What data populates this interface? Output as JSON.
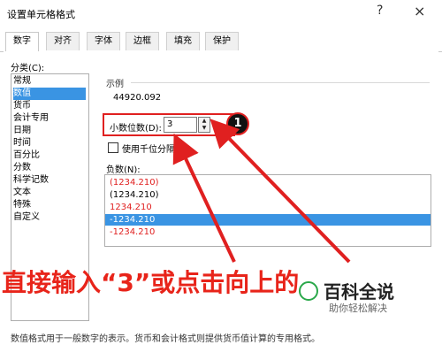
{
  "window": {
    "title": "设置单元格格式",
    "help": "?",
    "close": "×"
  },
  "tabs": [
    "数字",
    "对齐",
    "字体",
    "边框",
    "填充",
    "保护"
  ],
  "category": {
    "label": "分类(C):",
    "items": [
      "常规",
      "数值",
      "货币",
      "会计专用",
      "日期",
      "时间",
      "百分比",
      "分数",
      "科学记数",
      "文本",
      "特殊",
      "自定义"
    ],
    "selected": "数值"
  },
  "sample": {
    "label": "示例",
    "value": "44920.092"
  },
  "decimal": {
    "label": "小数位数(D):",
    "value": "3",
    "badge": "1"
  },
  "thousands": {
    "label": "使用千位分隔符",
    "checked": false
  },
  "negative": {
    "label": "负数(N):",
    "items": [
      {
        "text": "(1234.210)",
        "color": "#e02020"
      },
      {
        "text": "(1234.210)",
        "color": "#000000"
      },
      {
        "text": "1234.210",
        "color": "#e02020"
      },
      {
        "text": "-1234.210",
        "color": "#ffffff"
      },
      {
        "text": "-1234.210",
        "color": "#e02020"
      }
    ],
    "selected_index": 3
  },
  "footer": "数值格式用于一般数字的表示。货币和会计格式则提供货币值计算的专用格式。",
  "annotation": {
    "text": "直接输入“3”或点击向上的",
    "color": "#e8241a"
  },
  "watermark": {
    "main": "百科全说",
    "sub": "助你轻松解决"
  },
  "colors": {
    "accent": "#3a94e3",
    "annotation_red": "#e02020"
  }
}
